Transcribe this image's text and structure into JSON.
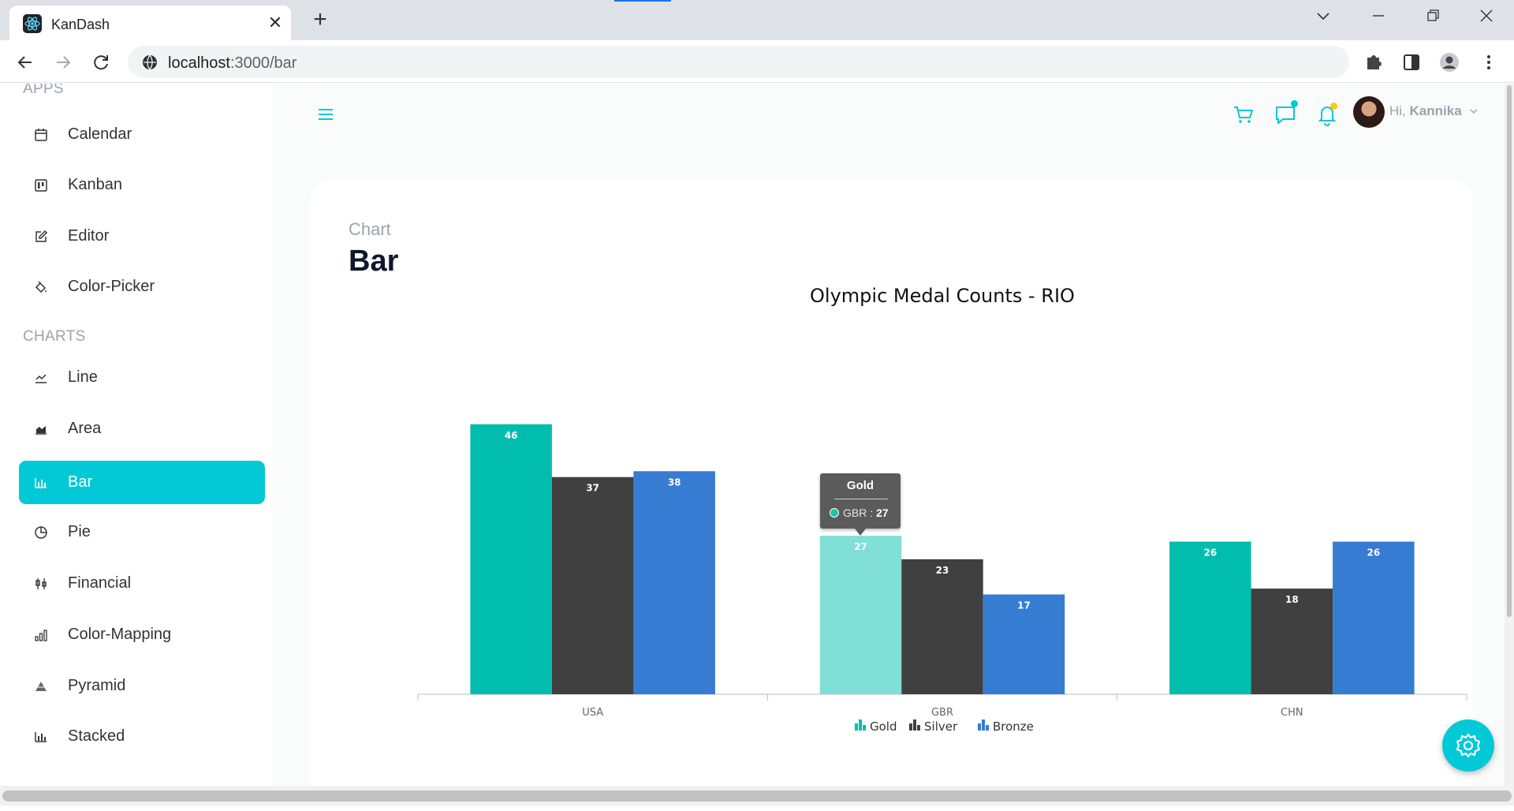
{
  "browser": {
    "tab_title": "KanDash",
    "url_host": "localhost",
    "url_path": ":3000/bar"
  },
  "sidebar": {
    "apps_title": "APPS",
    "apps": [
      {
        "label": "Calendar",
        "icon": "calendar-icon"
      },
      {
        "label": "Kanban",
        "icon": "kanban-icon"
      },
      {
        "label": "Editor",
        "icon": "edit-icon"
      },
      {
        "label": "Color-Picker",
        "icon": "paint-bucket-icon"
      }
    ],
    "charts_title": "CHARTS",
    "charts": [
      {
        "label": "Line",
        "icon": "line-chart-icon"
      },
      {
        "label": "Area",
        "icon": "area-chart-icon"
      },
      {
        "label": "Bar",
        "icon": "bar-chart-icon",
        "active": true
      },
      {
        "label": "Pie",
        "icon": "pie-chart-icon"
      },
      {
        "label": "Financial",
        "icon": "financial-icon"
      },
      {
        "label": "Color-Mapping",
        "icon": "color-mapping-icon"
      },
      {
        "label": "Pyramid",
        "icon": "pyramid-icon"
      },
      {
        "label": "Stacked",
        "icon": "stacked-chart-icon"
      }
    ]
  },
  "header": {
    "greeting": "Hi,",
    "user_name": "Kannika",
    "accent_color": "#03c9d7"
  },
  "page": {
    "category": "Chart",
    "title": "Bar"
  },
  "chart_data": {
    "type": "bar",
    "title": "Olympic Medal Counts - RIO",
    "categories": [
      "USA",
      "GBR",
      "CHN"
    ],
    "series": [
      {
        "name": "Gold",
        "color": "#00bdae",
        "values": [
          46,
          27,
          26
        ]
      },
      {
        "name": "Silver",
        "color": "#404041",
        "values": [
          37,
          23,
          18
        ]
      },
      {
        "name": "Bronze",
        "color": "#357cd2",
        "values": [
          38,
          17,
          26
        ]
      }
    ],
    "ylim": [
      0,
      50
    ],
    "legend_position": "bottom",
    "highlighted": {
      "series": "Gold",
      "category": "GBR",
      "color": "#80dfd6"
    },
    "tooltip": {
      "title": "Gold",
      "label": "GBR",
      "value": "27"
    }
  }
}
